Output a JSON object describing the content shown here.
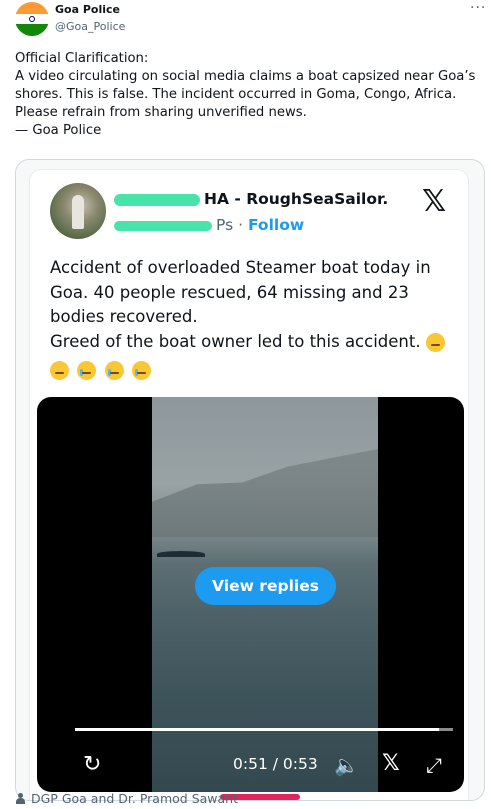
{
  "post": {
    "author_name": "Goa Police",
    "author_handle": "@Goa_Police",
    "more_label": "···",
    "body_lines": [
      "Official Clarification:",
      "A video circulating on social media claims a boat capsized near Goa’s",
      "shores. This is false. The incident occurred in Goma, Congo, Africa.",
      "Please refrain from sharing unverified news.",
      "— Goa Police"
    ],
    "avatar_colors": {
      "saffron": "#ff9933",
      "white": "#ffffff",
      "green": "#138808",
      "chakra": "#000080"
    }
  },
  "quoted": {
    "name_visible": "HA - RoughSeaSailor.",
    "handle_visible": "Ps",
    "follow_label": "Follow",
    "separator": "·",
    "platform_icon": "x-logo-icon",
    "text_lines": [
      "Accident of overloaded Steamer boat today in",
      "Goa. 40 people rescued, 64 missing and 23",
      "bodies recovered.",
      "Greed of the boat owner led to this accident."
    ],
    "emojis": [
      "thinking-face-icon",
      "face-with-monocle-icon",
      "crying-face-icon",
      "crying-face-icon",
      "downcast-sweat-face-icon"
    ],
    "redaction_color": "#33e0a0"
  },
  "video": {
    "view_replies_label": "View replies",
    "time_display": "0:51 / 0:53",
    "progress": 0.962,
    "controls": [
      "replay-icon",
      "volume-icon",
      "x-logo-icon",
      "fullscreen-icon"
    ]
  },
  "footer": {
    "tagged_icon": "person-icon",
    "tagged_text": "DGP Goa and Dr. Pramod Sawant"
  },
  "colors": {
    "accent": "#1d9bf0",
    "text": "#0f1419",
    "muted": "#536471",
    "border": "#cfd9de"
  }
}
